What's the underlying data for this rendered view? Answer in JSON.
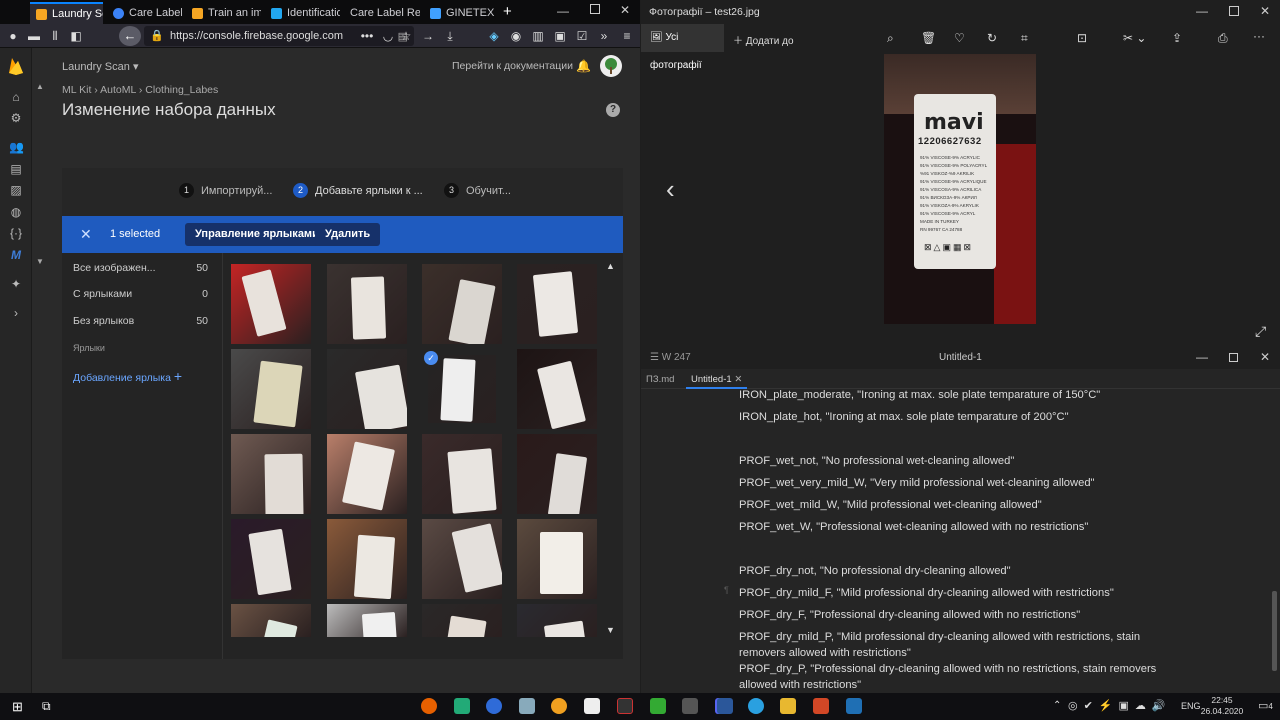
{
  "browser": {
    "tabs": [
      {
        "label": "Laundry Sc",
        "color": "#f6a623"
      },
      {
        "label": "Care Labels -",
        "color": "#3b82f6"
      },
      {
        "label": "Train an imag",
        "color": "#f6a623"
      },
      {
        "label": "Identification",
        "color": "#22a7f0"
      },
      {
        "label": "Care Label Recog",
        "color": "#e05050"
      },
      {
        "label": "GINETEX > Ca",
        "color": "#40a0ff"
      }
    ],
    "new_tab": "+",
    "url": "https://console.firebase.google.com"
  },
  "firebase": {
    "project": "Laundry Scan",
    "docs_link": "Перейти к документации",
    "breadcrumb": [
      "ML Kit",
      "AutoML",
      "Clothing_Labes"
    ],
    "page_title": "Изменение набора данных",
    "steps": [
      {
        "num": "1",
        "label": "Импортируй..."
      },
      {
        "num": "2",
        "label": "Добавьте ярлыки к ..."
      },
      {
        "num": "3",
        "label": "Обучит..."
      }
    ],
    "selection": {
      "count": "1 selected",
      "manage_btn": "Управление ярлыками",
      "delete_btn": "Удалить"
    },
    "filters": [
      {
        "label": "Все изображен...",
        "count": "50"
      },
      {
        "label": "С ярлыками",
        "count": "0"
      },
      {
        "label": "Без ярлыков",
        "count": "50"
      }
    ],
    "labels_heading": "Ярлыки",
    "add_label": "Добавление ярлыка",
    "add_label_icon": "+"
  },
  "photos": {
    "title": "Фотографії – test26.jpg",
    "all_photos": "Усі фотографії",
    "add_to": "Додати до",
    "label_text": {
      "brand": "mavi",
      "code": "12206627632",
      "lines": [
        "91% VISCOSE-9% ACRYLIC",
        "91% VISCOSE-9% POLYACRYL",
        "%91 VISKOZ-%9 AKRILIK",
        "91% VISCOSE-9% ACRYLIQUE",
        "91% VISCOSA-9% ACRILICA",
        "91% ВИСКОЗА-9% АКРИЛ",
        "91% VISKOZA-9% AKRYLIK",
        "91% VISCOSE-9% ACRYL",
        "MADE IN TURKEY",
        "RN 99767 CA 24788"
      ]
    }
  },
  "editor": {
    "word_count": "W 247",
    "title": "Untitled-1",
    "tabs": [
      "ПЗ.md",
      "Untitled-1"
    ],
    "lines": [
      "IRON_plate_moderate, \"Ironing at max. sole plate temparature of 150°C\"",
      "IRON_plate_hot, \"Ironing at max. sole plate temparature of 200°C\"",
      "",
      "PROF_wet_not, \"No professional wet-cleaning allowed\"",
      "PROF_wet_very_mild_W, \"Very mild professional wet-cleaning allowed\"",
      "PROF_wet_mild_W, \"Mild professional wet-cleaning allowed\"",
      "PROF_wet_W, \"Professional wet-cleaning allowed with no restrictions\"",
      "",
      "PROF_dry_not, \"No professional dry-cleaning allowed\"",
      "PROF_dry_mild_F, \"Mild professional dry-cleaning allowed with restrictions\"",
      "PROF_dry_F, \"Professional dry-cleaning allowed with no restrictions\"",
      "PROF_dry_mild_P, \"Mild professional dry-cleaning allowed with restrictions, stain removers allowed with restrictions\"",
      "PROF_dry_P, \"Professional dry-cleaning allowed with no restrictions, stain removers allowed with restrictions\""
    ]
  },
  "taskbar": {
    "lang": "ENG",
    "time": "22:45",
    "date": "26.04.2020",
    "notifications": "4"
  }
}
